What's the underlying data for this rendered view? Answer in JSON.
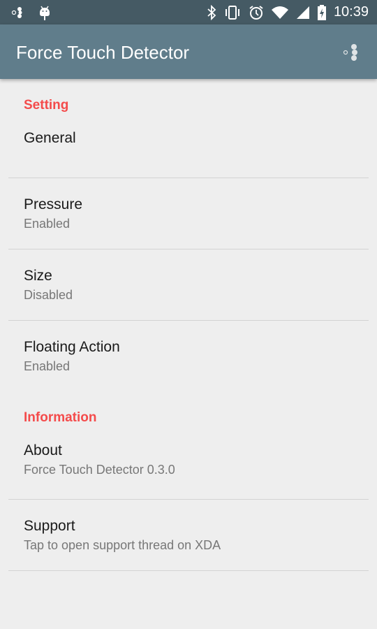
{
  "status_bar": {
    "time": "10:39",
    "left_icons": [
      "notification-dots-icon",
      "android-icon"
    ],
    "right_icons": [
      "bluetooth-icon",
      "vibrate-icon",
      "alarm-icon",
      "wifi-icon",
      "cell-signal-icon",
      "battery-charging-icon"
    ]
  },
  "app_bar": {
    "title": "Force Touch Detector",
    "menu_icon": "overflow-dots-icon"
  },
  "colors": {
    "status_bar": "#455a64",
    "app_bar": "#607d8b",
    "accent": "#f44b4b",
    "background": "#eeeeee"
  },
  "sections": [
    {
      "category": "Setting",
      "items": [
        {
          "title": "General",
          "summary": ""
        },
        {
          "title": "Pressure",
          "summary": "Enabled"
        },
        {
          "title": "Size",
          "summary": "Disabled"
        },
        {
          "title": "Floating Action",
          "summary": "Enabled"
        }
      ]
    },
    {
      "category": "Information",
      "items": [
        {
          "title": "About",
          "summary": "Force Touch Detector 0.3.0"
        },
        {
          "title": "Support",
          "summary": "Tap to open support thread on XDA"
        }
      ]
    }
  ]
}
